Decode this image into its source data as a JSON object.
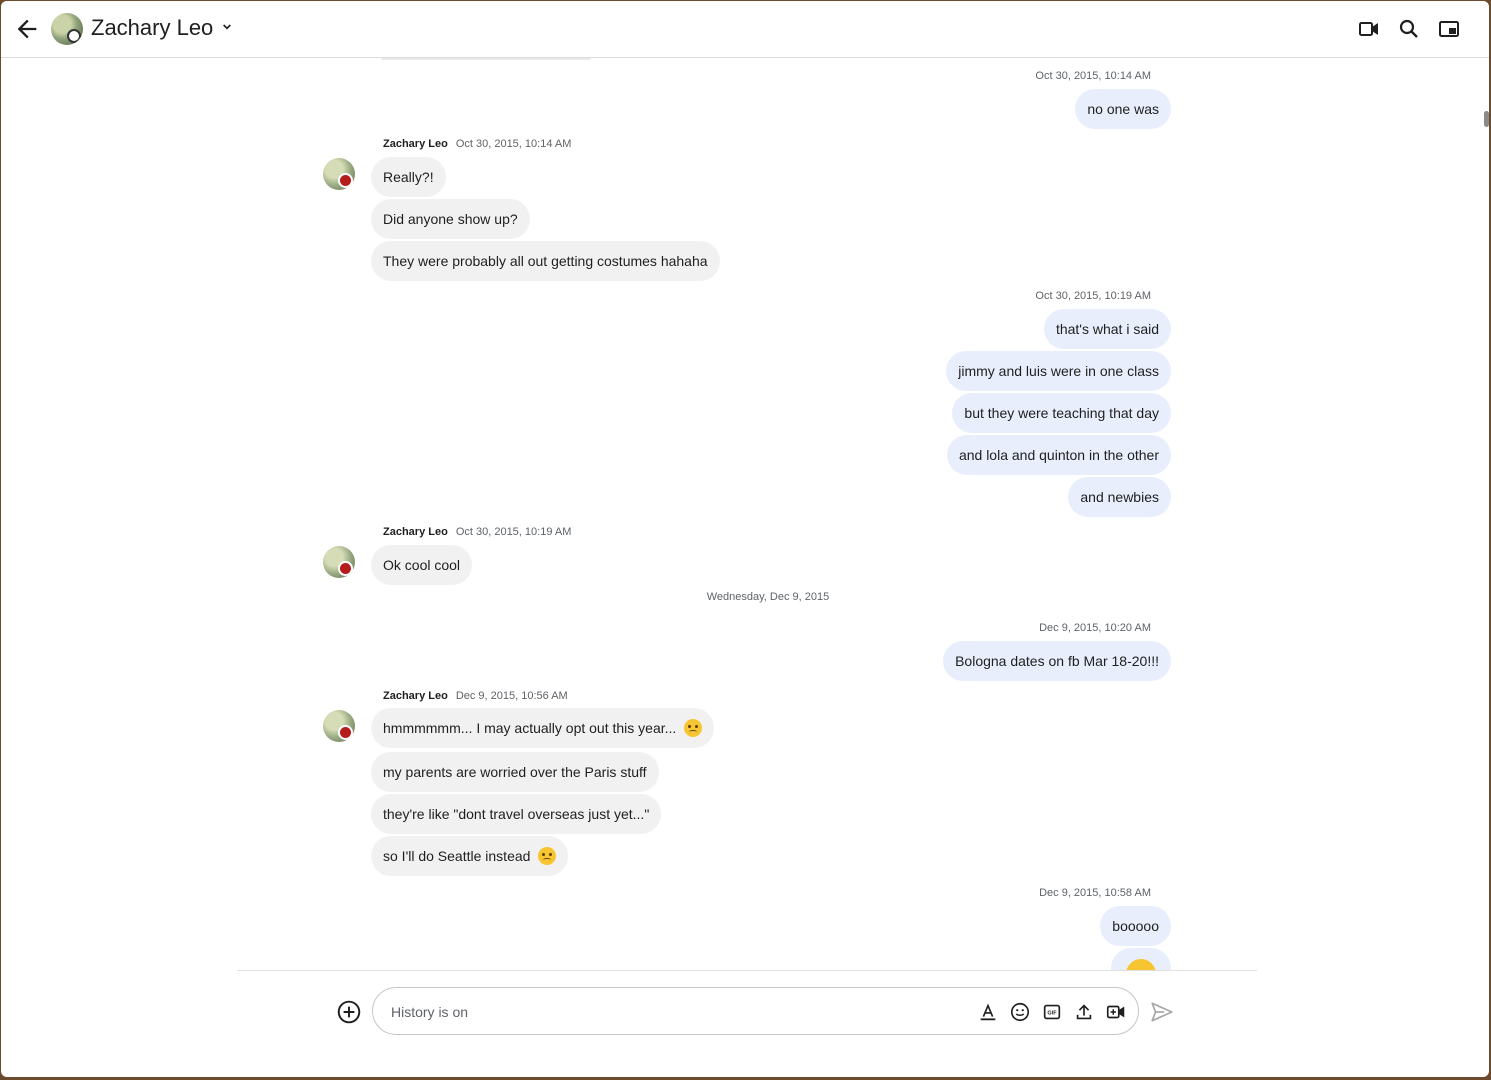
{
  "header": {
    "contact_name": "Zachary Leo",
    "icons": [
      "back-arrow-icon",
      "chevron-down-icon",
      "video-call-icon",
      "search-icon",
      "picture-in-picture-icon"
    ]
  },
  "messages": {
    "m1": {
      "time": "Oct 30, 2015, 10:14 AM",
      "text": "no one was"
    },
    "g1": {
      "sender": "Zachary Leo",
      "time": "Oct 30, 2015, 10:14 AM",
      "lines": [
        "Really?!",
        "Did anyone show up?",
        "They were probably all out getting costumes hahaha"
      ]
    },
    "m2": {
      "time": "Oct 30, 2015, 10:19 AM",
      "lines": [
        "that's what i said",
        "jimmy and luis were in one class",
        "but they were teaching that day",
        "and lola and quinton in the other",
        "and newbies"
      ]
    },
    "g2": {
      "sender": "Zachary Leo",
      "time": "Oct 30, 2015, 10:19 AM",
      "lines": [
        "Ok cool cool"
      ]
    },
    "divider": "Wednesday, Dec 9, 2015",
    "m3": {
      "time": "Dec 9, 2015, 10:20 AM",
      "text": "Bologna dates on fb Mar 18-20!!!"
    },
    "g3": {
      "sender": "Zachary Leo",
      "time": "Dec 9, 2015, 10:56 AM",
      "lines": [
        "hmmmmmm... I may actually opt out this year...",
        "my parents are worried over the Paris stuff",
        "they're like \"dont travel overseas just yet...\"",
        "so I'll do Seattle instead"
      ]
    },
    "m4": {
      "time": "Dec 9, 2015, 10:58 AM",
      "text": "booooo"
    }
  },
  "composer": {
    "placeholder": "History is on",
    "icons": [
      "add-icon",
      "format-text-icon",
      "emoji-icon",
      "gif-icon",
      "upload-icon",
      "video-meeting-icon",
      "send-icon"
    ]
  },
  "colors": {
    "my_bubble": "#e8eefc",
    "their_bubble": "#f1f1f1"
  }
}
